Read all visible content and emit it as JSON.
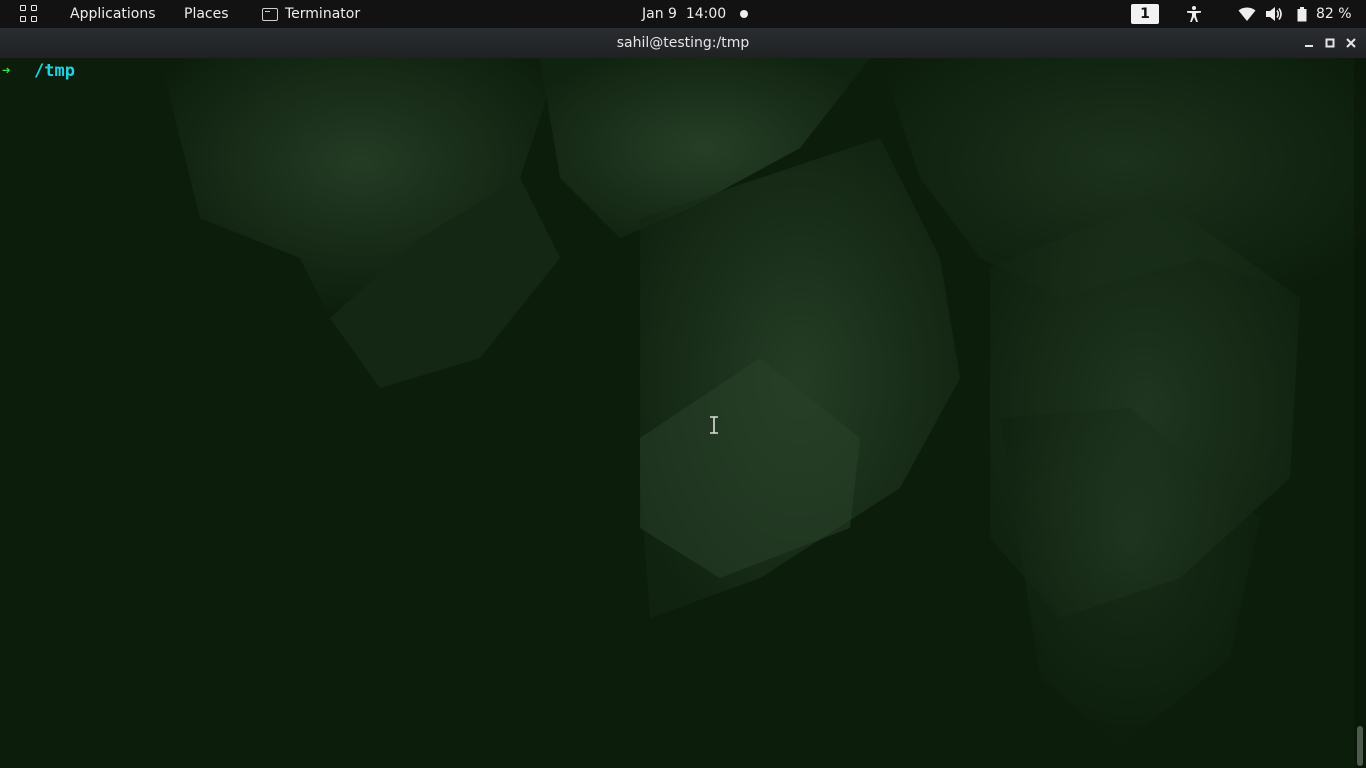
{
  "topbar": {
    "activities_icon": "grid-icon",
    "applications_label": "Applications",
    "places_label": "Places",
    "app_name": "Terminator",
    "app_icon": "terminal-icon",
    "clock": "Jan 9  14:00",
    "workspace": "1",
    "tray_icons": [
      "accessibility-icon",
      "wifi-icon",
      "volume-icon",
      "battery-icon"
    ],
    "battery_text": "82 %"
  },
  "window": {
    "title": "sahil@testing:/tmp",
    "buttons": [
      "minimize",
      "maximize",
      "close"
    ]
  },
  "terminal": {
    "prompt_arrow": "➜",
    "prompt_dir": "/tmp",
    "colors": {
      "arrow": "#2ee64a",
      "dir": "#21d3e0",
      "background": "#0c1d0c"
    }
  }
}
